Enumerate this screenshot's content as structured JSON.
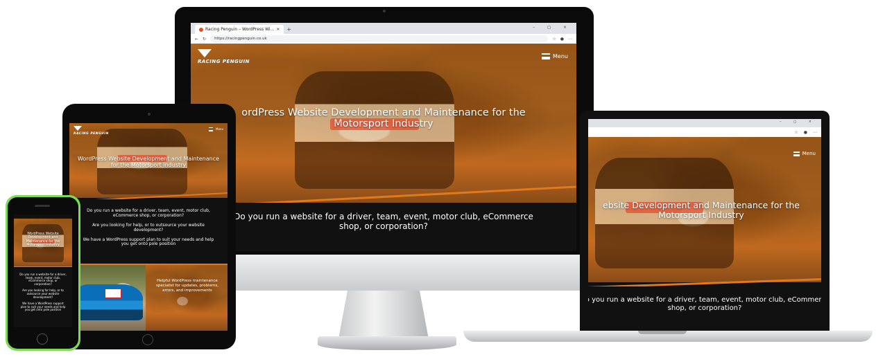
{
  "site": {
    "brand": "RACING PENGUIN",
    "menu_label": "Menu",
    "hero_title_line1": "WordPress Website Development and Maintenance for the",
    "hero_title_line2": "Motorsport Industry",
    "intro_question": "Do you run a website for a driver, team, event, motor club, eCommerce shop, or corporation?",
    "help_question": "Are you looking for help, or to outsource your website development?",
    "support_plan": "We have a WordPress support plan to suit your needs and help you get onto pole position",
    "maintenance_blurb": "Helpful WordPress maintenance specialist for updates, problems, errors, and improvements"
  },
  "imac": {
    "tab_title": "Racing Penguin – WordPress Wi...",
    "tab_close": "×",
    "new_tab": "+",
    "url": "https://racingpenguin.co.uk",
    "window_controls": "–  ◻  ×",
    "hero_title_line1": "ordPress Website Development and Maintenance for the",
    "hero_title_line2": "Motorsport Industry",
    "band_text_line1": "Do you run a website for a driver, team, event, motor club, eCommerce",
    "band_text_line2": "shop, or corporation?"
  },
  "laptop": {
    "window_controls": "–  ◻  ×",
    "hero_title_line1": "ebsite Development and Maintenance for the",
    "hero_title_line2": "Motorsport Industry",
    "band_text_line1": "Do you run a website for a driver, team, event, motor club, eCommerce",
    "band_text_line2": "shop, or corporation?"
  },
  "tablet": {
    "hero_title_line1": "WordPress Website Development and Maintenance",
    "hero_title_line2": "for the Motorsport Industry"
  },
  "phone": {
    "hero_title": "WordPress Website Development and Maintenance for the Motorsport Industry",
    "intro_question": "Do you run a website for a driver, team, event, motor club, eCommerce shop, or corporation?",
    "help_question": "Are you looking for help, or to outsource your website development?",
    "support_plan": "We have a WordPress support plan to suit your needs and help you get onto pole position"
  },
  "colors": {
    "accent_orange": "#e07a1d",
    "phone_case": "#7ed957",
    "dark_band": "#111111"
  }
}
